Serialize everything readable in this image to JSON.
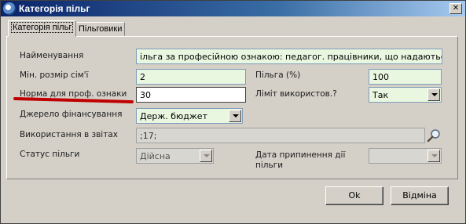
{
  "window": {
    "title": "Категорія пільг",
    "close": "✕"
  },
  "tabs": [
    {
      "label": "Категорія пільг"
    },
    {
      "label": "Пільговики"
    }
  ],
  "form": {
    "name_label": "Найменування",
    "name_value": "ільга за професійною ознакою: педагог. працівники, що надаються по довідці",
    "min_family_label": "Мін. розмір сім'ї",
    "min_family_value": "2",
    "benefit_label": "Пільга (%)",
    "benefit_value": "100",
    "norm_label": "Норма для проф. ознаки",
    "norm_value": "30",
    "limit_label": "Ліміт використов.?",
    "limit_value": "Так",
    "funding_label": "Джерело фінансування",
    "funding_value": "Держ. бюджет",
    "reports_label": "Використання в звітах",
    "reports_value": ";17;",
    "status_label": "Статус пільги",
    "status_value": "Дійсна",
    "end_date_label_line1": "Дата припинення дії",
    "end_date_label_line2": "пільги",
    "end_date_value": ""
  },
  "buttons": {
    "ok": "Ok",
    "cancel": "Відміна"
  },
  "colors": {
    "title_bar": "#0a246a",
    "annotation_line": "#c00000",
    "field_green": "#eaf7e0"
  }
}
